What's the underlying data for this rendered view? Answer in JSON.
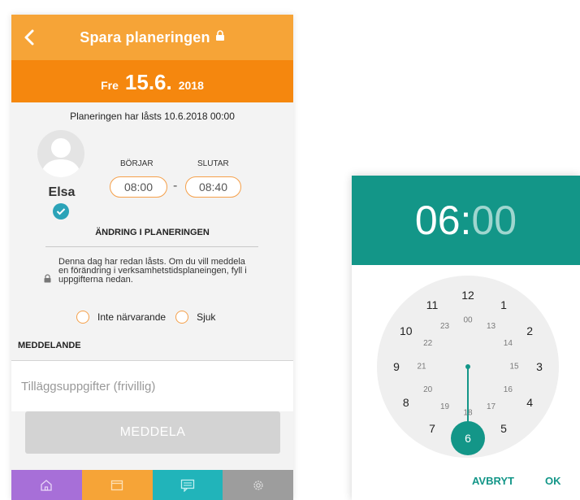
{
  "planning": {
    "header_title": "Spara planeringen",
    "date": {
      "weekday": "Fre",
      "day_month": "15.6.",
      "year": "2018"
    },
    "locked_text": "Planeringen har låsts 10.6.2018 00:00",
    "person": {
      "name": "Elsa"
    },
    "time": {
      "start_label": "BÖRJAR",
      "end_label": "SLUTAR",
      "start": "08:00",
      "end": "08:40",
      "separator": "-"
    },
    "change_heading": "ÄNDRING I PLANERINGEN",
    "lock_note": "Denna dag har redan låsts. Om du vill meddela en förändring i verksamhetstidsplaneingen, fyll i uppgifterna nedan.",
    "options": [
      "Inte närvarande",
      "Sjuk"
    ],
    "message_label": "MEDDELANDE",
    "message_placeholder": "Tilläggsuppgifter (frivillig)",
    "send_label": "MEDDELA",
    "nav": [
      {
        "icon": "home-icon",
        "color": "#a76fd8"
      },
      {
        "icon": "calendar-icon",
        "color": "#f6a437"
      },
      {
        "icon": "chat-icon",
        "color": "#21b4ba"
      },
      {
        "icon": "gear-icon",
        "color": "#9d9d9d"
      }
    ],
    "colors": {
      "header": "#f6a437",
      "date_bar": "#f5870e",
      "accent_outline": "#f5a04a",
      "check": "#2ba3b8"
    }
  },
  "time_picker": {
    "hours": "06",
    "colon": ":",
    "minutes": "00",
    "outer_numbers": [
      "12",
      "1",
      "2",
      "3",
      "4",
      "5",
      "6",
      "7",
      "8",
      "9",
      "10",
      "11"
    ],
    "inner_numbers": [
      "00",
      "13",
      "14",
      "15",
      "16",
      "17",
      "18",
      "19",
      "20",
      "21",
      "22",
      "23"
    ],
    "selected": "6",
    "cancel_label": "AVBRYT",
    "ok_label": "OK",
    "colors": {
      "header": "#139688",
      "minutes_dim": "#9fd6cf",
      "dial_bg": "#efefef",
      "selector": "#139688"
    }
  }
}
